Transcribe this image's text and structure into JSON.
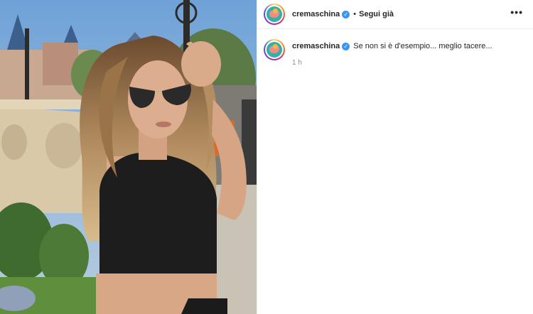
{
  "post": {
    "username": "cremaschina",
    "verified_icon": "verified-badge-icon",
    "separator": "•",
    "follow_label": "Segui già",
    "more_icon": "more-options-icon",
    "more_label": "•••"
  },
  "caption": {
    "username": "cremaschina",
    "text": "Se non si è d'esempio... meglio tacere...",
    "time": "1 h"
  },
  "colors": {
    "verified": "#3897f0",
    "text": "#262626",
    "muted": "#8e8e8e"
  }
}
